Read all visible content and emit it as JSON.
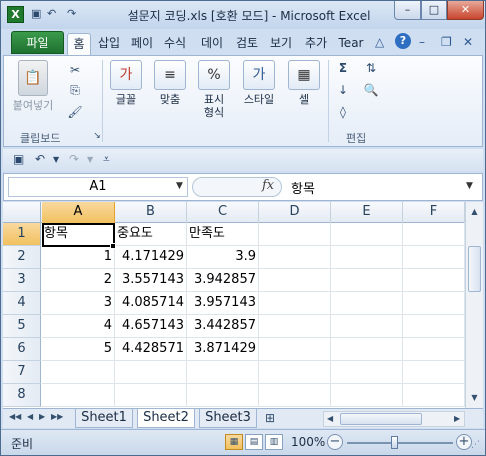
{
  "window": {
    "title": "설문지 코딩.xls  [호환 모드] - Microsoft Excel",
    "app_icon": "X",
    "minimize": "–",
    "maximize": "□",
    "close": "✕"
  },
  "ribbon_tabs": {
    "file": "파일",
    "items": [
      "홈",
      "삽입",
      "페이",
      "수식",
      "데이",
      "검토",
      "보기",
      "추가",
      "Tear"
    ],
    "active": "홈",
    "help": "?"
  },
  "ribbon": {
    "paste_label": "붙여넣기",
    "clipboard_group": "클립보드",
    "font_label": "글꼴",
    "font_icon": "가",
    "align_label": "맞춤",
    "align_icon": "≡",
    "number_label": "표시\n형식",
    "number_icon": "%",
    "styles_label": "스타일",
    "styles_icon": "가",
    "cells_label": "셀",
    "cells_icon": "▦",
    "editing_group": "편집",
    "sum_icon": "Σ",
    "sort_icon": "⇅",
    "fill_icon": "↓",
    "find_icon": "🔍",
    "clear_icon": "◊"
  },
  "formula_bar": {
    "name_box": "A1",
    "fx": "fx",
    "value": "항목"
  },
  "grid": {
    "columns": [
      "A",
      "B",
      "C",
      "D",
      "E",
      "F"
    ],
    "rows": [
      "1",
      "2",
      "3",
      "4",
      "5",
      "6",
      "7",
      "8"
    ],
    "selected_cell": "A1",
    "cells": [
      [
        "항목",
        "중요도",
        "만족도"
      ],
      [
        "1",
        "4.171429",
        "3.9"
      ],
      [
        "2",
        "3.557143",
        "3.942857"
      ],
      [
        "3",
        "4.085714",
        "3.957143"
      ],
      [
        "4",
        "4.657143",
        "3.442857"
      ],
      [
        "5",
        "4.428571",
        "3.871429"
      ]
    ]
  },
  "sheets": {
    "tabs": [
      "Sheet1",
      "Sheet2",
      "Sheet3"
    ],
    "active": "Sheet2"
  },
  "status_bar": {
    "ready": "준비",
    "zoom": "100%",
    "zoom_level_percent": 100
  }
}
